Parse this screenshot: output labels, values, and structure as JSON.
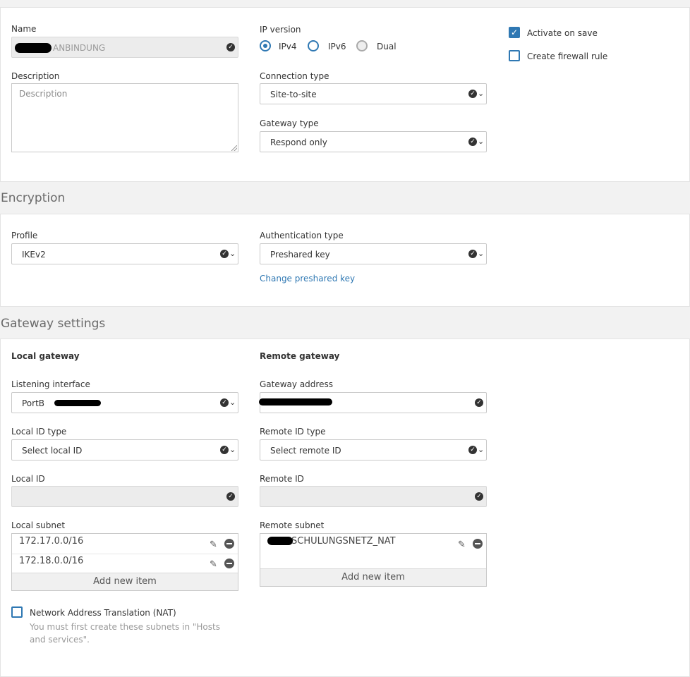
{
  "general": {
    "name_label": "Name",
    "name_value": "ANBINDUNG",
    "description_label": "Description",
    "description_placeholder": "Description",
    "ip_version_label": "IP version",
    "ip_options": [
      {
        "label": "IPv4",
        "state": "checked"
      },
      {
        "label": "IPv6",
        "state": "unchecked"
      },
      {
        "label": "Dual",
        "state": "disabled"
      }
    ],
    "connection_type_label": "Connection type",
    "connection_type_value": "Site-to-site",
    "gateway_type_label": "Gateway type",
    "gateway_type_value": "Respond only",
    "activate_on_save_label": "Activate on save",
    "create_firewall_rule_label": "Create firewall rule"
  },
  "encryption": {
    "title": "Encryption",
    "profile_label": "Profile",
    "profile_value": "IKEv2",
    "auth_type_label": "Authentication type",
    "auth_type_value": "Preshared key",
    "change_key_link": "Change preshared key"
  },
  "gateway": {
    "title": "Gateway settings",
    "local_heading": "Local gateway",
    "remote_heading": "Remote gateway",
    "listening_interface_label": "Listening interface",
    "listening_interface_value": "PortB",
    "gateway_address_label": "Gateway address",
    "local_id_type_label": "Local ID type",
    "local_id_type_value": "Select local ID",
    "remote_id_type_label": "Remote ID type",
    "remote_id_type_value": "Select remote ID",
    "local_id_label": "Local ID",
    "remote_id_label": "Remote ID",
    "local_subnet_label": "Local subnet",
    "local_subnets": [
      "172.17.0.0/16",
      "172.18.0.0/16"
    ],
    "remote_subnet_label": "Remote subnet",
    "remote_subnets": [
      "SCHULUNGSNETZ_NAT"
    ],
    "add_new_item": "Add new item",
    "nat_label": "Network Address Translation (NAT)",
    "nat_hint": "You must first create these subnets in \"Hosts and services\"."
  },
  "colors": {
    "accent": "#2f78b3",
    "section_bg": "#f2f2f2"
  }
}
